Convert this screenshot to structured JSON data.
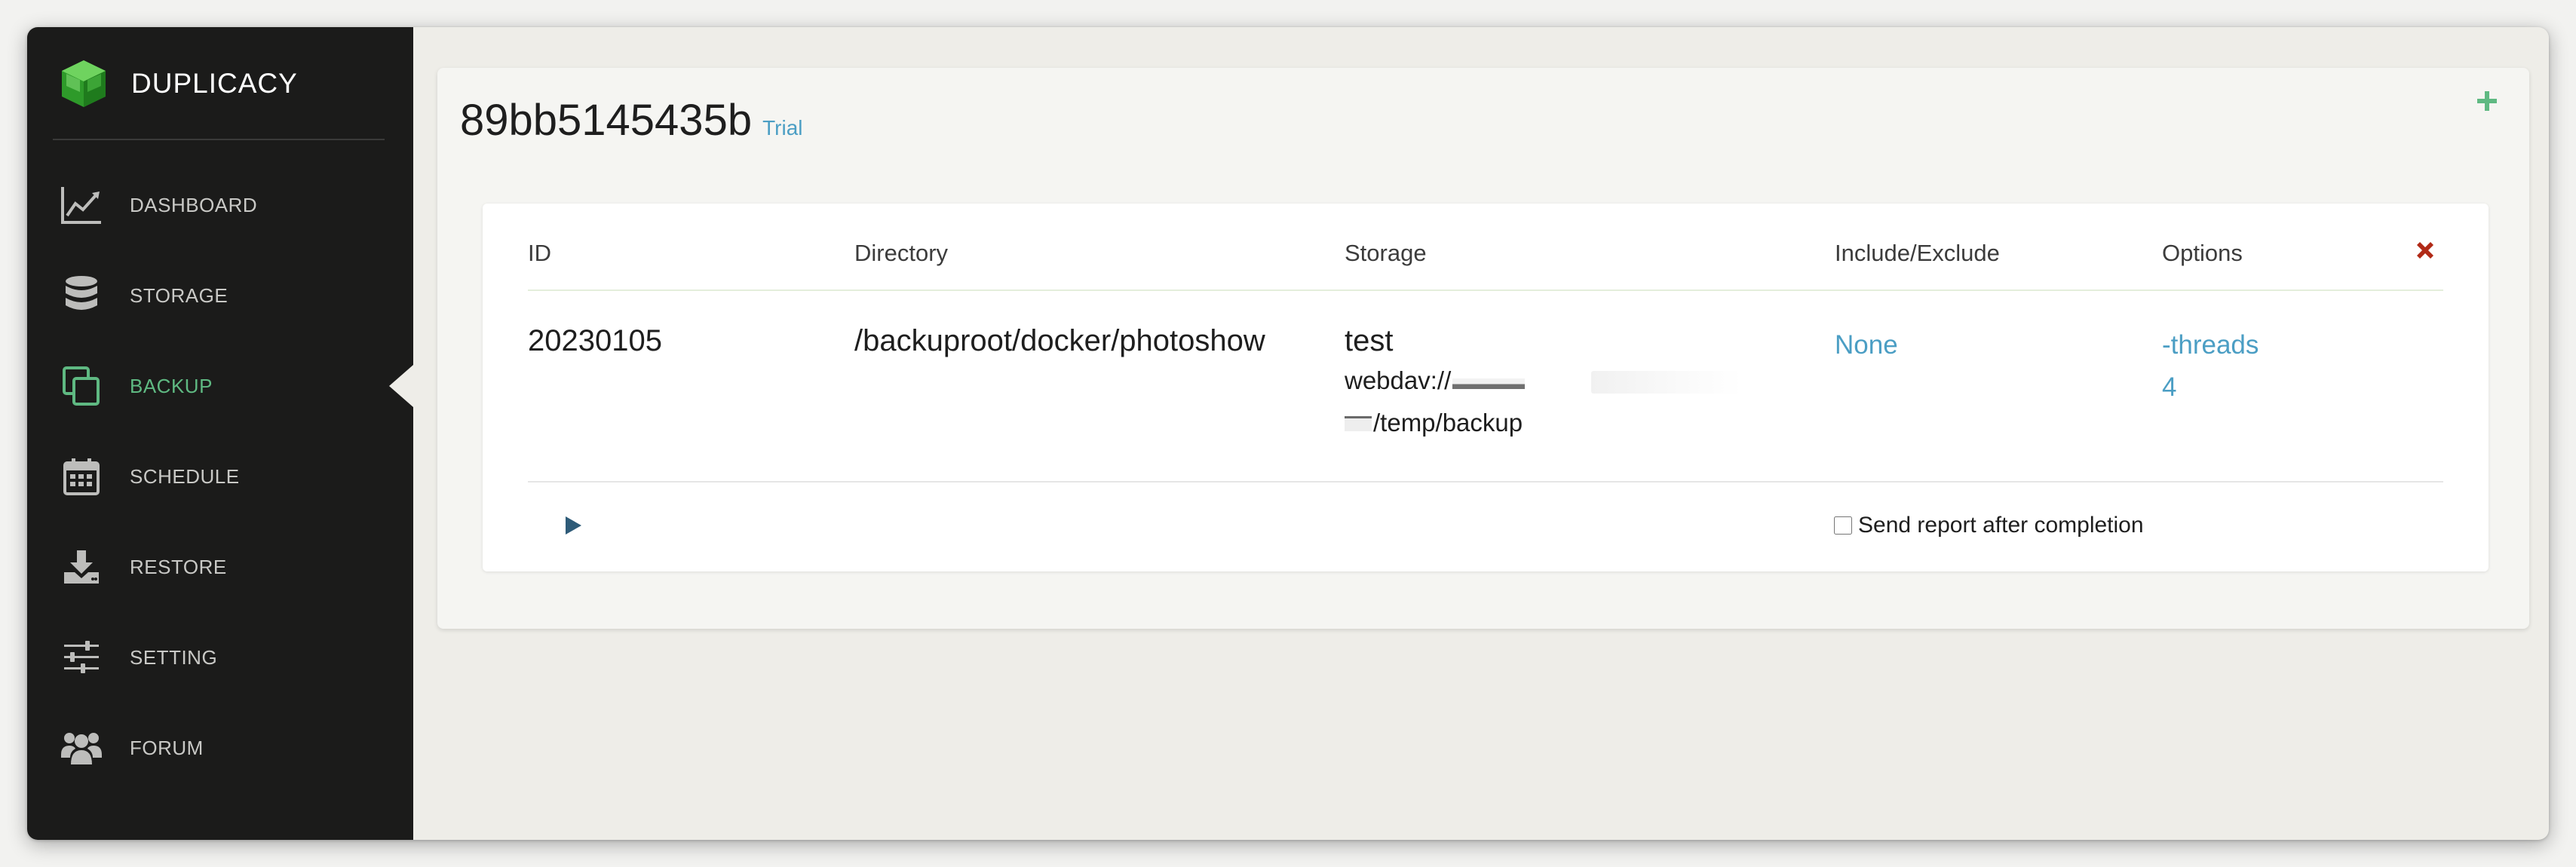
{
  "app": {
    "name": "DUPLICACY"
  },
  "sidebar": {
    "items": [
      {
        "label": "DASHBOARD",
        "icon": "chart-line-icon",
        "active": false
      },
      {
        "label": "STORAGE",
        "icon": "database-icon",
        "active": false
      },
      {
        "label": "BACKUP",
        "icon": "copy-icon",
        "active": true
      },
      {
        "label": "SCHEDULE",
        "icon": "calendar-icon",
        "active": false
      },
      {
        "label": "RESTORE",
        "icon": "download-icon",
        "active": false
      },
      {
        "label": "SETTING",
        "icon": "sliders-icon",
        "active": false
      },
      {
        "label": "FORUM",
        "icon": "users-icon",
        "active": false
      }
    ]
  },
  "header": {
    "computer_id": "89bb5145435b",
    "license": "Trial"
  },
  "table": {
    "columns": [
      "ID",
      "Directory",
      "Storage",
      "Include/Exclude",
      "Options"
    ],
    "row": {
      "id": "20230105",
      "directory": "/backuproot/docker/photoshow",
      "storage_name": "test",
      "storage_url_start": "webdav://",
      "storage_url_end": "/temp/backup",
      "include_exclude": "None",
      "options_line1": "-threads",
      "options_line2": "4"
    },
    "report_label": "Send report after completion",
    "report_checked": false
  },
  "colors": {
    "accent_green": "#5fb982",
    "link_blue": "#4b9ec4",
    "delete_red": "#b12a17",
    "sidebar_bg": "#1b1b1a"
  }
}
